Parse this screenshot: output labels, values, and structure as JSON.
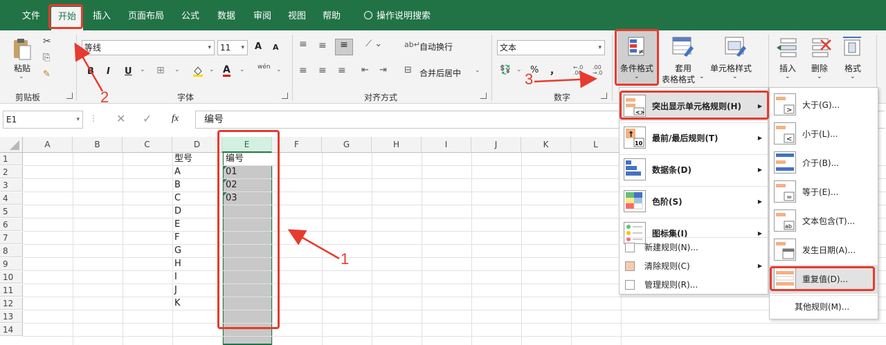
{
  "tabs": [
    "文件",
    "开始",
    "插入",
    "页面布局",
    "公式",
    "数据",
    "审阅",
    "视图",
    "帮助"
  ],
  "tell_me": "操作说明搜索",
  "clipboard": {
    "paste": "粘贴",
    "group": "剪贴板"
  },
  "font": {
    "name": "等线",
    "size": "11",
    "bold": "B",
    "italic": "I",
    "underline": "U",
    "grow": "A",
    "shrink": "A",
    "color_a": "A",
    "phonetic": "wén",
    "group": "字体"
  },
  "alignment": {
    "wrap": "自动换行",
    "merge": "合并后居中",
    "group": "对齐方式"
  },
  "number": {
    "format": "文本",
    "percent": "%",
    "comma": "，",
    "group": "数字"
  },
  "styles": {
    "conditional": "条件格式",
    "table_line1": "套用",
    "table_line2": "表格格式",
    "cell_styles": "单元格样式"
  },
  "cells": {
    "insert": "插入",
    "delete": "删除",
    "format": "格式"
  },
  "formula_bar": {
    "name_box": "E1",
    "fx": "fx",
    "value": "编号"
  },
  "columns": [
    "A",
    "B",
    "C",
    "D",
    "E",
    "F",
    "G",
    "H",
    "I",
    "J",
    "K",
    "L"
  ],
  "rows": [
    "1",
    "2",
    "3",
    "4",
    "5",
    "6",
    "7",
    "8",
    "9",
    "10",
    "11",
    "12",
    "13",
    "14"
  ],
  "col_d": [
    "型号",
    "A",
    "B",
    "C",
    "D",
    "E",
    "F",
    "G",
    "H",
    "I",
    "J",
    "K"
  ],
  "col_e": [
    "编号",
    "01",
    "02",
    "03"
  ],
  "menu": {
    "items": [
      "突出显示单元格规则(H)",
      "最前/最后规则(T)",
      "数据条(D)",
      "色阶(S)",
      "图标集(I)"
    ],
    "small": [
      "新建规则(N)...",
      "清除规则(C)",
      "管理规则(R)..."
    ]
  },
  "submenu": {
    "items": [
      "大于(G)...",
      "小于(L)...",
      "介于(B)...",
      "等于(E)...",
      "文本包含(T)...",
      "发生日期(A)...",
      "重复值(D)..."
    ],
    "other": "其他规则(M)..."
  },
  "annotations": [
    "1",
    "2",
    "3"
  ],
  "colors": {
    "brand": "#217346",
    "highlight": "#e63b2e",
    "selected_fill": "#c8c8c8"
  }
}
